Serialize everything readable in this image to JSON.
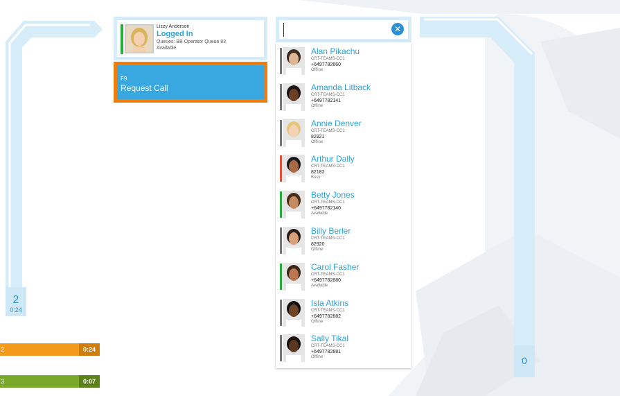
{
  "agent": {
    "name": "Lizzy Anderson",
    "state": "Logged In",
    "queues": "Queues: BB Operator Queue 83",
    "availability": "Available"
  },
  "request_call": {
    "key": "F9",
    "label": "Request Call"
  },
  "search": {
    "value": "",
    "placeholder": ""
  },
  "left_queue": {
    "count": "2",
    "time": "0:24"
  },
  "call_bars": [
    {
      "edge": "2",
      "time": "0:24",
      "color": "#f39a1b",
      "time_bg": "#d07d0c"
    },
    {
      "edge": "3",
      "time": "0:07",
      "color": "#7aa82a",
      "time_bg": "#5b8119"
    }
  ],
  "right_queue": {
    "count": "0"
  },
  "contacts": [
    {
      "name": "Alan Pikachu",
      "team": "CRT-TEAMS-CC1",
      "number": "+6497782660",
      "status": "Offline",
      "status_color": "#777777"
    },
    {
      "name": "Amanda Litback",
      "team": "CRT-TEAMS-CC1",
      "number": "+6497782141",
      "status": "Offline",
      "status_color": "#777777"
    },
    {
      "name": "Annie Denver",
      "team": "CRT-TEAMS-CC1",
      "number": "82921",
      "status": "Offline",
      "status_color": "#777777"
    },
    {
      "name": "Arthur Dally",
      "team": "CRT-TEAMS-CC1",
      "number": "82182",
      "status": "Busy",
      "status_color": "#e74c3c"
    },
    {
      "name": "Betty Jones",
      "team": "CRT-TEAMS-CC1",
      "number": "+6497782140",
      "status": "Available",
      "status_color": "#27ae3a"
    },
    {
      "name": "Billy Berler",
      "team": "CRT-TEAMS-CC1",
      "number": "82920",
      "status": "Offline",
      "status_color": "#777777"
    },
    {
      "name": "Carol Fasher",
      "team": "CRT-TEAMS-CC1",
      "number": "+6497782880",
      "status": "Available",
      "status_color": "#27ae3a"
    },
    {
      "name": "Isla Atkins",
      "team": "CRT-TEAMS-CC1",
      "number": "+6497782882",
      "status": "Offline",
      "status_color": "#777777"
    },
    {
      "name": "Sally Tikal",
      "team": "CRT-TEAMS-CC1",
      "number": "+6497782881",
      "status": "Offline",
      "status_color": "#777777"
    }
  ],
  "icons": {
    "clear": "close-circle-icon"
  }
}
